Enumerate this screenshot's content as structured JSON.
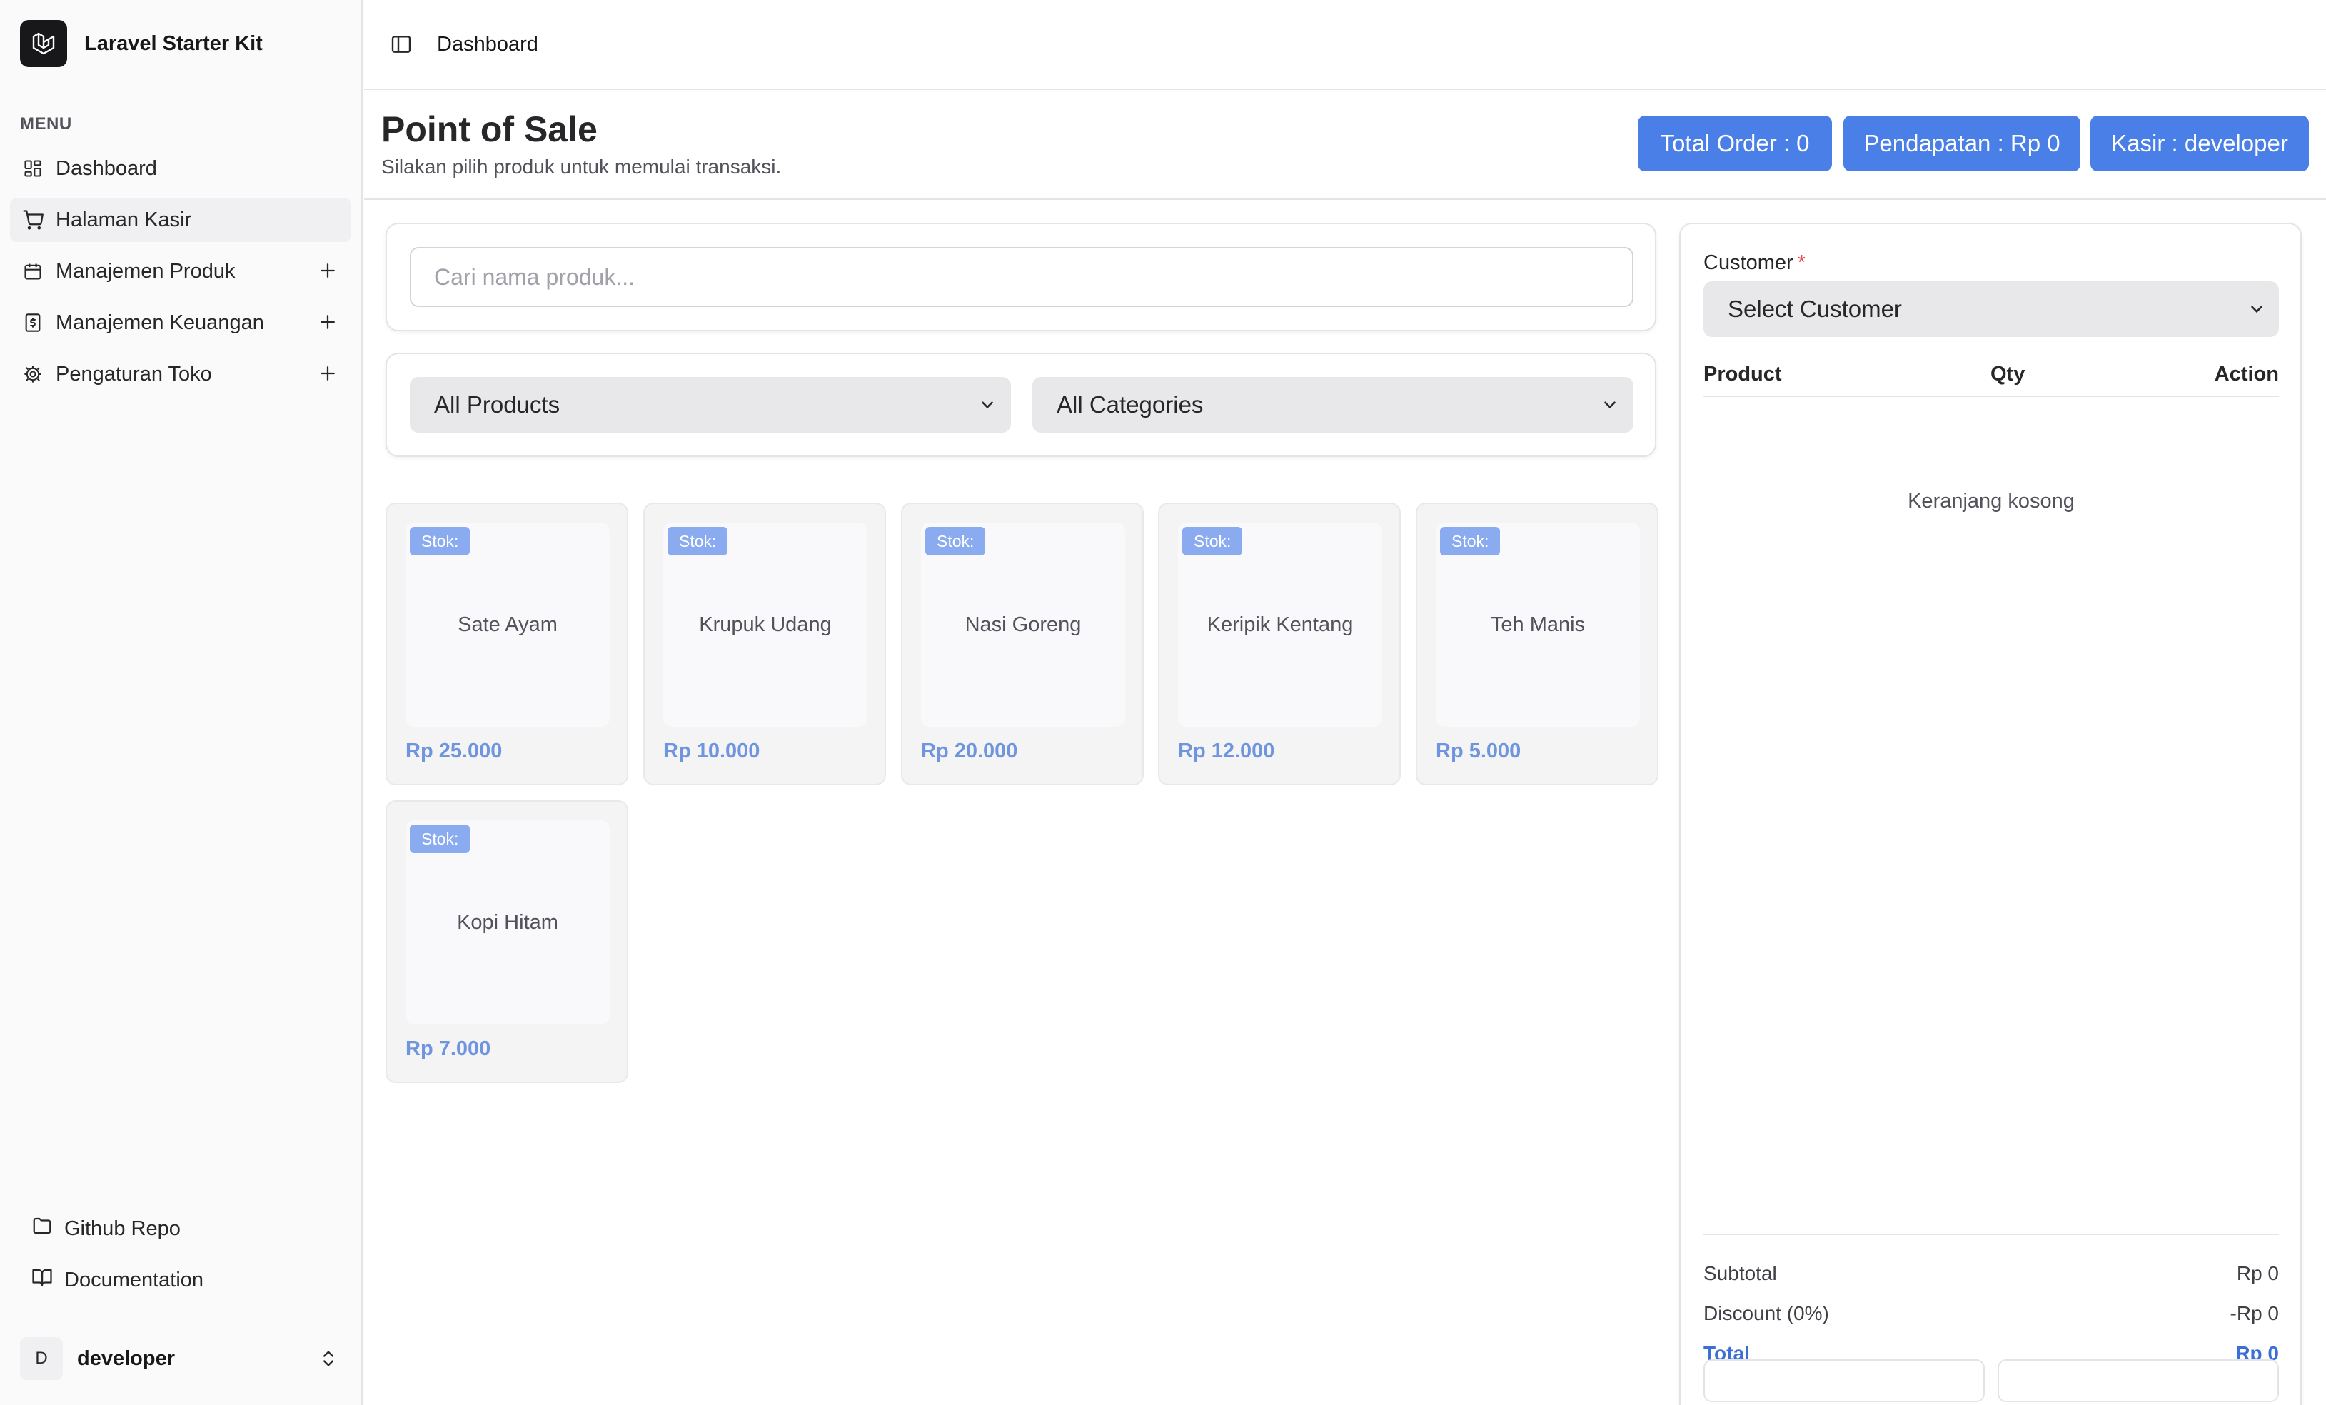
{
  "app": {
    "name": "Laravel Starter Kit"
  },
  "sidebar": {
    "menu_heading": "MENU",
    "items": [
      {
        "label": "Dashboard",
        "icon": "dashboard-grid-icon",
        "expandable": false
      },
      {
        "label": "Halaman Kasir",
        "icon": "shopping-cart-icon",
        "expandable": false,
        "active": true
      },
      {
        "label": "Manajemen Produk",
        "icon": "calendar-box-icon",
        "expandable": true
      },
      {
        "label": "Manajemen Keuangan",
        "icon": "dollar-receipt-icon",
        "expandable": true
      },
      {
        "label": "Pengaturan Toko",
        "icon": "gear-icon",
        "expandable": true
      }
    ],
    "bottom_links": [
      {
        "label": "Github Repo",
        "icon": "folder-icon"
      },
      {
        "label": "Documentation",
        "icon": "book-icon"
      }
    ],
    "user": {
      "initial": "D",
      "name": "developer"
    }
  },
  "header": {
    "breadcrumb": "Dashboard"
  },
  "page": {
    "title": "Point of Sale",
    "subtitle": "Silakan pilih produk untuk memulai transaksi.",
    "stats": {
      "total_order": "Total Order : 0",
      "pendapatan": "Pendapatan : Rp 0",
      "kasir": "Kasir : developer"
    }
  },
  "search": {
    "placeholder": "Cari nama produk...",
    "value": ""
  },
  "filters": {
    "product_filter": "All Products",
    "category_filter": "All Categories"
  },
  "products": [
    {
      "name": "Sate Ayam",
      "stock_label": "Stok:",
      "price": "Rp 25.000"
    },
    {
      "name": "Krupuk Udang",
      "stock_label": "Stok:",
      "price": "Rp 10.000"
    },
    {
      "name": "Nasi Goreng",
      "stock_label": "Stok:",
      "price": "Rp 20.000"
    },
    {
      "name": "Keripik Kentang",
      "stock_label": "Stok:",
      "price": "Rp 12.000"
    },
    {
      "name": "Teh Manis",
      "stock_label": "Stok:",
      "price": "Rp 5.000"
    },
    {
      "name": "Kopi Hitam",
      "stock_label": "Stok:",
      "price": "Rp 7.000"
    }
  ],
  "cart": {
    "customer_label": "Customer",
    "required_mark": "*",
    "customer_select": "Select Customer",
    "columns": {
      "product": "Product",
      "qty": "Qty",
      "action": "Action"
    },
    "empty_text": "Keranjang kosong",
    "summary": {
      "subtotal_label": "Subtotal",
      "subtotal_value": "Rp 0",
      "discount_label": "Discount (0%)",
      "discount_value": "-Rp 0",
      "total_label": "Total",
      "total_value": "Rp 0"
    }
  },
  "colors": {
    "accent": "#4a7fe8",
    "stock_badge": "#8aabef",
    "price": "#7095df",
    "total": "#3b6fd6",
    "required": "#ef4444"
  }
}
